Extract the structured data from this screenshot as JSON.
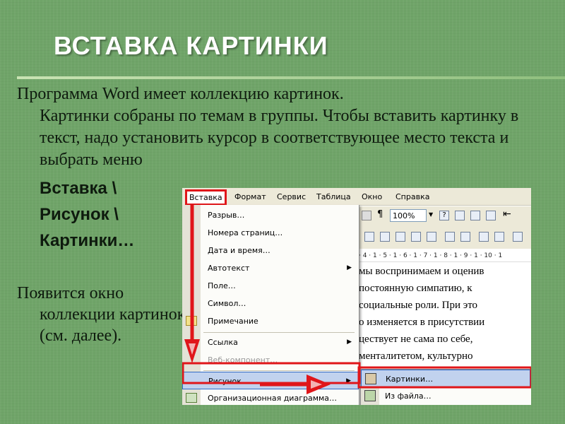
{
  "slide": {
    "title": "ВСТАВКА КАРТИНКИ",
    "paragraph1_first": "Программа Word имеет коллекцию картинок.",
    "paragraph1_rest": "Картинки собраны по темам в группы. Чтобы вставить картинку в текст, надо установить курсор в соответствующее место текста и выбрать меню",
    "menu_path": [
      "Вставка \\",
      "Рисунок \\",
      "Картинки…"
    ],
    "paragraph2_first": "Появится окно",
    "paragraph2_rest": "коллекции картинок (см. далее)."
  },
  "word": {
    "menubar": [
      "Вставка",
      "Формат",
      "Сервис",
      "Таблица",
      "Окно",
      "Справка"
    ],
    "zoom": "100%",
    "ruler": "· 4 · 1 · 5 · 1 · 6 · 1 · 7 · 1 · 8 · 1 · 9 · 1 · 10 · 1",
    "doc_lines": [
      "мы воспринимаем и оценив",
      "постоянную   симпатию,   к",
      "социальные роли. При это",
      "о изменяется в присутствии",
      "цествует не сама по себе,",
      "  менталитетом, культурно"
    ],
    "insert_menu": [
      {
        "label": "Разрыв…",
        "disabled": false,
        "submenu": false
      },
      {
        "label": "Номера страниц…",
        "disabled": false,
        "submenu": false
      },
      {
        "label": "Дата и время…",
        "disabled": false,
        "submenu": false
      },
      {
        "label": "Автотекст",
        "disabled": false,
        "submenu": true
      },
      {
        "label": "Поле…",
        "disabled": false,
        "submenu": false
      },
      {
        "label": "Символ…",
        "disabled": false,
        "submenu": false
      },
      {
        "label": "Примечание",
        "disabled": false,
        "submenu": false
      },
      {
        "label": "Ссылка",
        "disabled": false,
        "submenu": true
      },
      {
        "label": "Веб-компонент…",
        "disabled": true,
        "submenu": false
      },
      {
        "label": "Рисунок",
        "disabled": false,
        "submenu": true
      },
      {
        "label": "Организационная диаграмма…",
        "disabled": false,
        "submenu": false
      }
    ],
    "picture_submenu": [
      "Картинки…",
      "Из файла…"
    ]
  },
  "colors": {
    "background": "#6fa468",
    "highlight_red": "#e0161a",
    "menu_highlight": "#c1d2ee"
  }
}
